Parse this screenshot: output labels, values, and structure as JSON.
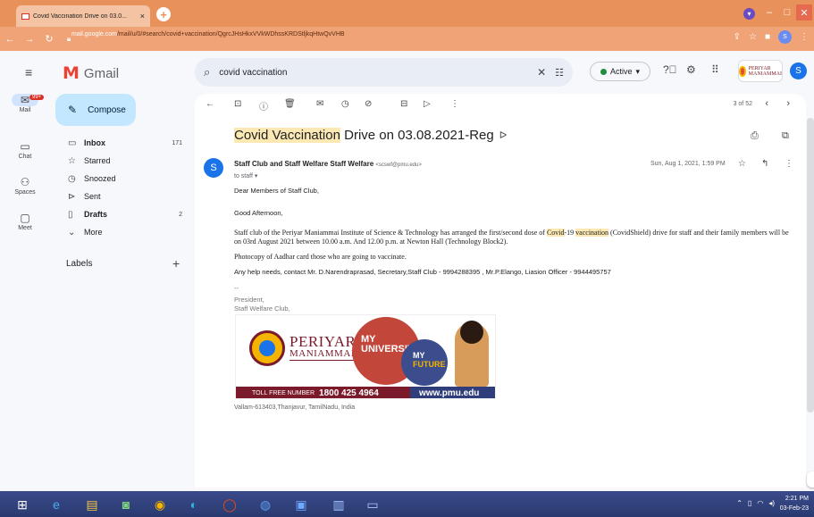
{
  "browser": {
    "tab_title": "Covid Vaccination Drive on 03.0...",
    "tab_close": "×",
    "new_tab": "+",
    "url_host": "mail.google.com",
    "url_path": "/mail/u/0/#search/covid+vaccination/QgrcJHsHkxVVkWDhssKRDStljkqHtwQvVHB",
    "profile_initial": "S",
    "minimize": "–",
    "maximize": "□",
    "close": "✕"
  },
  "gmail": {
    "app_name": "Gmail",
    "search_query": "covid vaccination",
    "status": "Active",
    "brand_text": "PERIYAR MANIAMMAI",
    "avatar_initial": "S"
  },
  "rail": {
    "mail_label": "Mail",
    "mail_badge": "99+",
    "chat_label": "Chat",
    "spaces_label": "Spaces",
    "meet_label": "Meet"
  },
  "nav": {
    "compose": "Compose",
    "items": [
      {
        "label": "Inbox",
        "count": "171"
      },
      {
        "label": "Starred",
        "count": ""
      },
      {
        "label": "Snoozed",
        "count": ""
      },
      {
        "label": "Sent",
        "count": ""
      },
      {
        "label": "Drafts",
        "count": "2"
      },
      {
        "label": "More",
        "count": ""
      }
    ],
    "labels_heading": "Labels",
    "labels_add": "+"
  },
  "toolbar": {
    "pager": "3 of 52"
  },
  "email": {
    "subject_hl": "Covid Vaccination",
    "subject_rest": " Drive on 03.08.2021-Reg",
    "sender_name": "Staff Club and Staff Welfare Staff Welfare",
    "sender_email": "<scswf@pmu.edu>",
    "to": "to staff ▾",
    "date": "Sun, Aug 1, 2021, 1:59 PM",
    "greeting1": "Dear Members of Staff Club,",
    "greeting2": "Good Afternoon,",
    "para1_a": "Staff club of the Periyar Maniammai Institute of Science & Technology has arranged the first/second dose of ",
    "para1_hl1": "Covid",
    "para1_b": "-19 ",
    "para1_hl2": "vaccination",
    "para1_c": " (CovidShield) drive for staff and their family members will be on 03rd August 2021 between 10.00 a.m. And 12.00 p.m. at Newton Hall (Technology Block2).",
    "para2": "Photocopy of Aadhar card those who are going to vaccinate.",
    "para3": "Any help needs, contact Mr. D.Narendraprasad, Secretary,Staff Club - 9994288395 , Mr.P.Elango, Liasion Officer - 9944495757",
    "sig_dash": "--",
    "sig_line1": "President,",
    "sig_line2": "Staff Welfare Club,",
    "banner_name1": "PERIYAR",
    "banner_name2": "MANIAMMAI",
    "banner_my1": "MY",
    "banner_university": "UNIVERSITY",
    "banner_my2": "MY",
    "banner_future": "FUTURE",
    "banner_tollfree_label": "TOLL FREE NUMBER",
    "banner_tollfree_number": "1800 425 4964",
    "banner_web": "www.pmu.edu",
    "address": "Vallam-613403,Thanjavur, TamilNadu, India"
  },
  "taskbar": {
    "time": "2:21 PM",
    "date": "03-Feb-23"
  }
}
